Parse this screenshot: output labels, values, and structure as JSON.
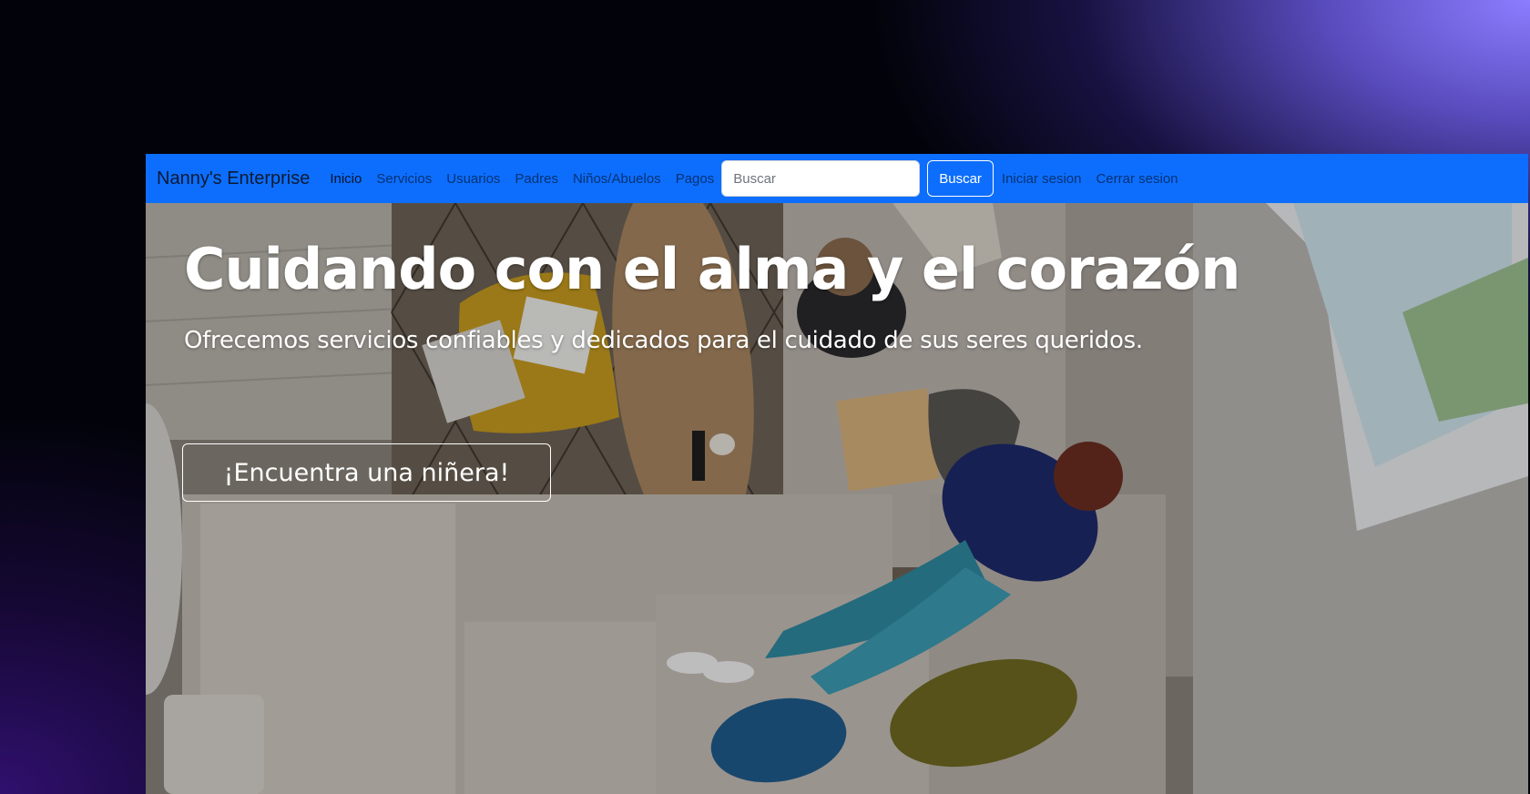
{
  "navbar": {
    "brand": "Nanny's Enterprise",
    "links": [
      "Inicio",
      "Servicios",
      "Usuarios",
      "Padres",
      "Niños/Abuelos",
      "Pagos"
    ],
    "active_link": "Inicio",
    "search": {
      "placeholder": "Buscar",
      "value": ""
    },
    "search_button_label": "Buscar",
    "login_label": "Iniciar sesion",
    "logout_label": "Cerrar sesion"
  },
  "hero": {
    "title": "Cuidando con el alma y el corazón",
    "subtitle": "Ofrecemos servicios confiables y dedicados para el cuidado de sus seres queridos.",
    "cta_label": "¡Encuentra una niñera!",
    "background_photo": "family-living-room-top-view"
  },
  "colors": {
    "navbar": "#0d6efd",
    "hero_text": "#ffffff"
  }
}
